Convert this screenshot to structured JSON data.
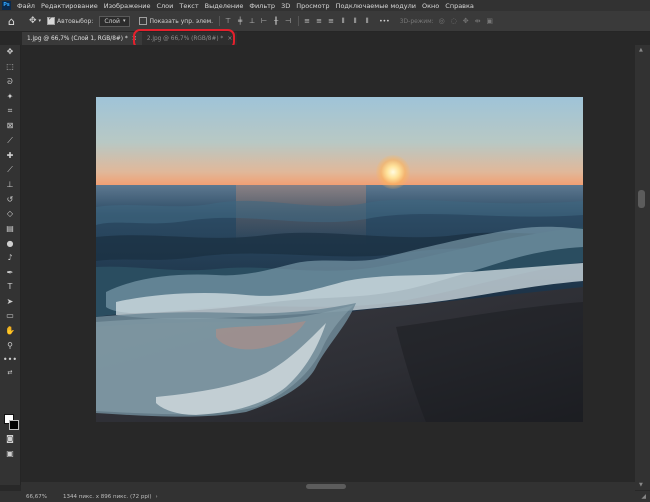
{
  "app_logo": "Ps",
  "menu": [
    "Файл",
    "Редактирование",
    "Изображение",
    "Слои",
    "Текст",
    "Выделение",
    "Фильтр",
    "3D",
    "Просмотр",
    "Подключаемые модули",
    "Окно",
    "Справка"
  ],
  "options": {
    "home_icon": "home-icon",
    "autoselect_label": "Автовыбор:",
    "autoselect_value": "Слой",
    "show_transform_label": "Показать упр. элем.",
    "more": "•••",
    "mode_3d": "3D-режим:"
  },
  "tabs": [
    {
      "label": "1.jpg @ 66,7% (Слой 1, RGB/8#) *",
      "close": "×"
    },
    {
      "label": "2.jpg @ 66,7% (RGB/8#) *",
      "close": "×"
    }
  ],
  "status": {
    "zoom": "66,67%",
    "info": "1344 пикс. x 896 пикс. (72 ppi)",
    "arrow": "›"
  },
  "colors": {
    "highlight": "#e3202c",
    "foreground": "#ffffff",
    "background": "#000000"
  }
}
